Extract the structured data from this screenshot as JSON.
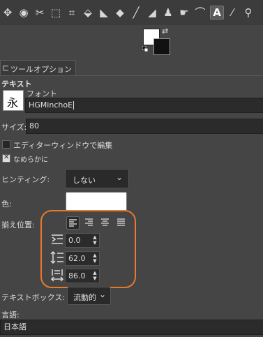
{
  "toolbar": {
    "tools": [
      {
        "icon": "move-icon",
        "glyph": "✥"
      },
      {
        "icon": "ellipse-select-icon",
        "glyph": "◉"
      },
      {
        "icon": "scissors-select-icon",
        "glyph": "✂"
      },
      {
        "icon": "foreground-select-icon",
        "glyph": "⬚"
      },
      {
        "icon": "crop-icon",
        "glyph": "⌗"
      },
      {
        "icon": "transform-icon",
        "glyph": "⬙"
      },
      {
        "icon": "warp-icon",
        "glyph": "◣"
      },
      {
        "icon": "bucket-fill-icon",
        "glyph": "◆"
      },
      {
        "icon": "paintbrush-icon",
        "glyph": "╱"
      },
      {
        "icon": "eraser-icon",
        "glyph": "◢"
      },
      {
        "icon": "clone-icon",
        "glyph": "♟"
      },
      {
        "icon": "smudge-icon",
        "glyph": "☛"
      },
      {
        "icon": "paths-icon",
        "glyph": "⌒"
      },
      {
        "icon": "text-icon",
        "glyph": "A",
        "active": true
      },
      {
        "icon": "color-picker-icon",
        "glyph": "⁄"
      },
      {
        "icon": "measure-icon",
        "glyph": "⚲"
      }
    ]
  },
  "tab": {
    "label": "ツールオプション"
  },
  "section_title": "テキスト",
  "font": {
    "label": "フォント",
    "preview_glyph": "永",
    "value": "HGMinchoE"
  },
  "size": {
    "label": "サイズ:",
    "value": "80"
  },
  "editor_checkbox": {
    "label": "エディターウィンドウで編集",
    "checked": false
  },
  "antialias_checkbox": {
    "label": "なめらかに",
    "checked": true
  },
  "hinting": {
    "label": "ヒンティング:",
    "value": "しない"
  },
  "color": {
    "label": "色:",
    "value": "#ffffff"
  },
  "justify": {
    "label": "揃え位置:",
    "options": [
      "left",
      "right",
      "center",
      "fill"
    ],
    "selected": "left"
  },
  "indent": {
    "value": "0.0"
  },
  "line_spacing": {
    "value": "62.0"
  },
  "letter_spacing": {
    "value": "86.0"
  },
  "textbox": {
    "label": "テキストボックス:",
    "value": "流動的"
  },
  "language": {
    "label": "言語:",
    "value": "日本語"
  },
  "highlight_color": "#e8782e"
}
